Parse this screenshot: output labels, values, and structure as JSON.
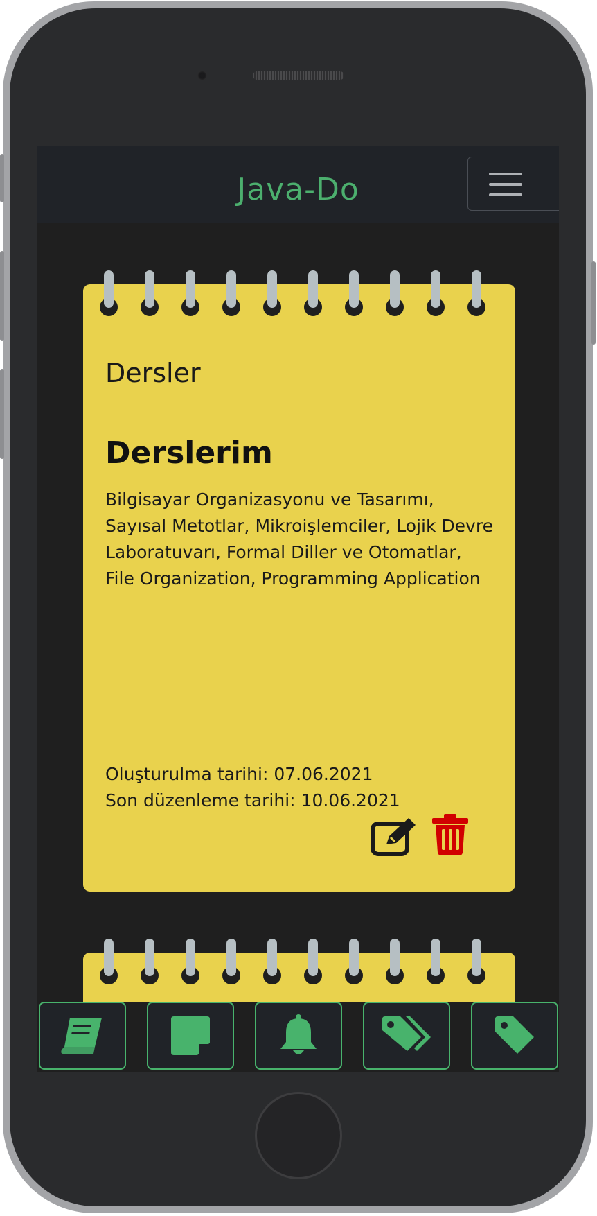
{
  "app": {
    "title": "Java-Do"
  },
  "navbar": {
    "toggle_label": "menu"
  },
  "notes": [
    {
      "category": "Dersler",
      "title": "Derslerim",
      "content": "Bilgisayar Organizasyonu ve Tasarımı, Sayısal Metotlar, Mikroişlemciler, Lojik Devre Laboratuvarı, Formal Diller ve Otomatlar, File Organization, Programming Application",
      "created": "Oluşturulma tarihi: 07.06.2021",
      "edited": "Son düzenleme tarihi: 10.06.2021",
      "edit_icon": "edit-icon",
      "delete_icon": "trash-icon"
    }
  ],
  "bottom_nav": [
    {
      "icon": "book-icon"
    },
    {
      "icon": "sticky-note-icon"
    },
    {
      "icon": "bell-icon"
    },
    {
      "icon": "tags-icon"
    },
    {
      "icon": "tag-icon"
    }
  ],
  "colors": {
    "accent": "#48b36c",
    "note": "#e9d24d",
    "delete": "#d10000",
    "navbar": "#202328"
  }
}
